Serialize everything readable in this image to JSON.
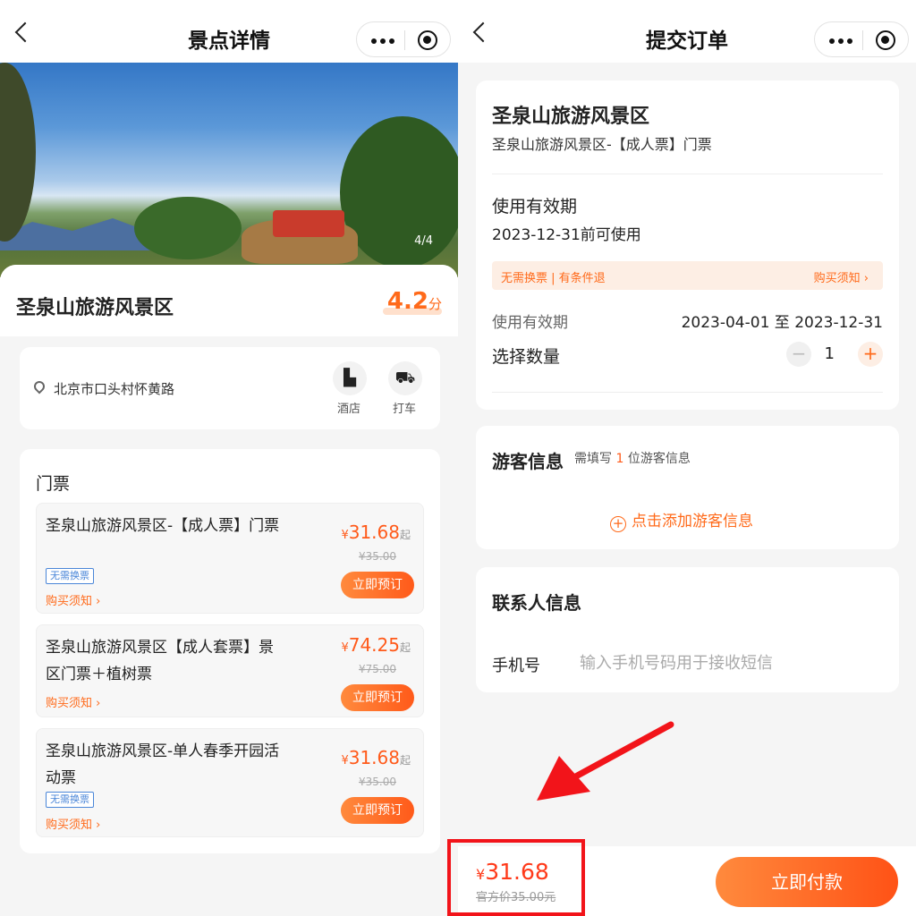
{
  "left": {
    "nav": {
      "title": "景点详情"
    },
    "hero": {
      "counter": "4/4"
    },
    "spot": {
      "name": "圣泉山旅游风景区",
      "score": "4.2",
      "score_unit": "分"
    },
    "address": {
      "text": "北京市口头村怀黄路",
      "hotel_label": "酒店",
      "taxi_label": "打车"
    },
    "tickets": {
      "title": "门票",
      "items": [
        {
          "name": "圣泉山旅游风景区-【成人票】门票",
          "tag": "无需换票",
          "notice": "购买须知 ›",
          "currency": "¥",
          "price": "31.68",
          "qualifier": "起",
          "original": "¥35.00",
          "button": "立即预订"
        },
        {
          "name": "圣泉山旅游风景区【成人套票】景区门票＋植树票",
          "tag": "",
          "notice": "购买须知 ›",
          "currency": "¥",
          "price": "74.25",
          "qualifier": "起",
          "original": "¥75.00",
          "button": "立即预订"
        },
        {
          "name": "圣泉山旅游风景区-单人春季开园活动票",
          "tag": "无需换票",
          "notice": "购买须知 ›",
          "currency": "¥",
          "price": "31.68",
          "qualifier": "起",
          "original": "¥35.00",
          "button": "立即预订"
        }
      ]
    }
  },
  "right": {
    "nav": {
      "title": "提交订单"
    },
    "order": {
      "spot_name": "圣泉山旅游风景区",
      "ticket_name": "圣泉山旅游风景区-【成人票】门票",
      "validity_label": "使用有效期",
      "validity_value": "2023-12-31前可使用",
      "strip_left": "无需换票 | 有条件退",
      "strip_right": "购买须知 ›",
      "period_label": "使用有效期",
      "period_value": "2023-04-01 至 2023-12-31",
      "qty_label": "选择数量",
      "qty_minus": "−",
      "qty_value": "1",
      "qty_plus": "+"
    },
    "visitor": {
      "title": "游客信息",
      "hint_pre": "需填写",
      "hint_num": "1",
      "hint_post": "位游客信息",
      "add_icon": "+",
      "add_label": "点击添加游客信息"
    },
    "contact": {
      "title": "联系人信息",
      "phone_label": "手机号",
      "phone_placeholder": "输入手机号码用于接收短信",
      "phone_value": ""
    },
    "footer": {
      "currency": "¥",
      "total": "31.68",
      "official": "官方价35.00元",
      "pay_label": "立即付款"
    }
  },
  "colors": {
    "accent": "#ff6a1a",
    "annotation": "#f2141a"
  }
}
